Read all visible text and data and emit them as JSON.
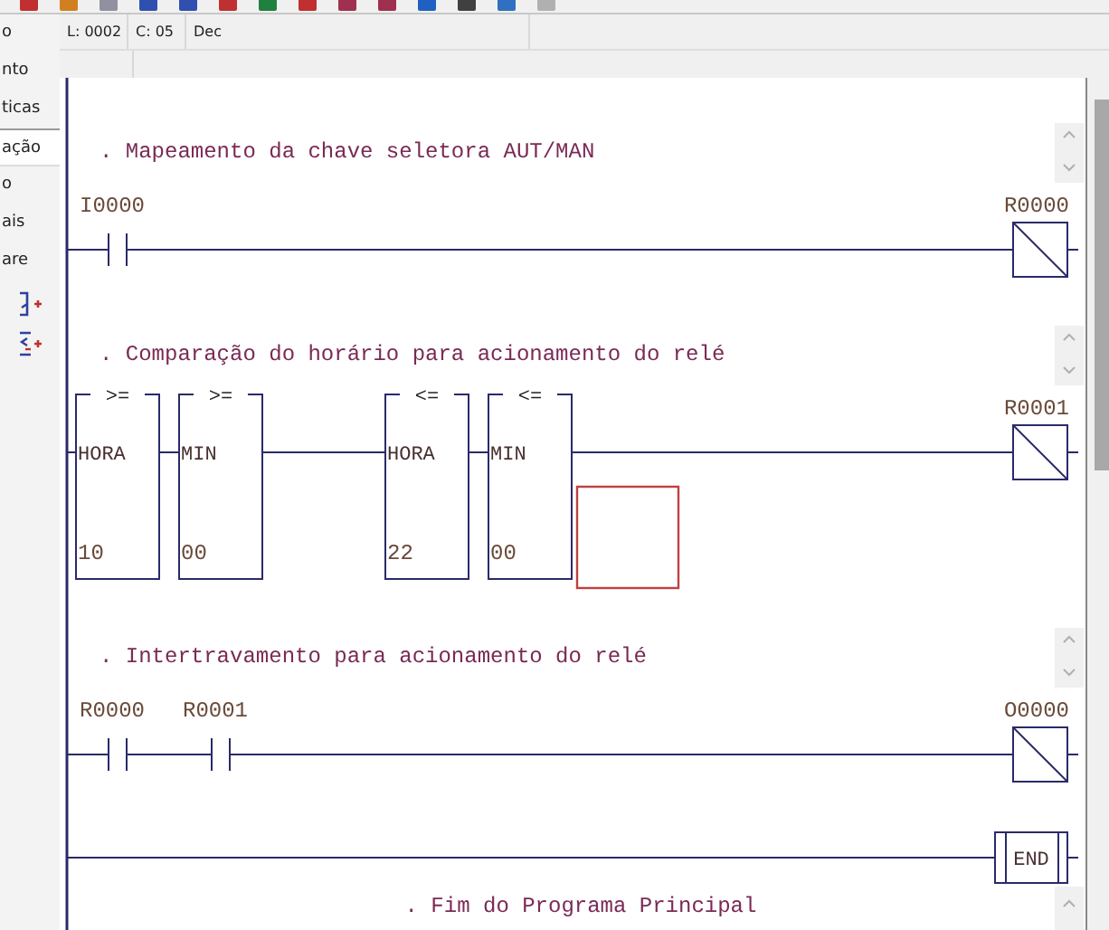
{
  "status_bar": {
    "line": "L: 0002",
    "column": "C: 05",
    "base": "Dec"
  },
  "sidebar": {
    "items": [
      {
        "label": "o",
        "selected": false
      },
      {
        "label": "nto",
        "selected": false
      },
      {
        "label": "ticas",
        "selected": false
      },
      {
        "label": "ação",
        "selected": true
      },
      {
        "label": "o",
        "selected": false
      },
      {
        "label": "ais",
        "selected": false
      },
      {
        "label": "are",
        "selected": false
      }
    ]
  },
  "ladder": {
    "rungs": [
      {
        "comment": ". Mapeamento da chave seletora AUT/MAN",
        "elements": [
          {
            "kind": "contact",
            "label": "I0000"
          }
        ],
        "coil": {
          "kind": "coil",
          "label": "R0000"
        }
      },
      {
        "comment": ". Comparação do horário para acionamento do relé",
        "elements": [
          {
            "kind": "compare",
            "op": ">=",
            "operand": "HORA",
            "value": "10"
          },
          {
            "kind": "compare",
            "op": ">=",
            "operand": "MIN",
            "value": "00"
          },
          {
            "kind": "wire"
          },
          {
            "kind": "compare",
            "op": "<=",
            "operand": "HORA",
            "value": "22"
          },
          {
            "kind": "compare",
            "op": "<=",
            "operand": "MIN",
            "value": "00"
          },
          {
            "kind": "cursor"
          }
        ],
        "coil": {
          "kind": "coil",
          "label": "R0001"
        }
      },
      {
        "comment": ". Intertravamento para acionamento do relé",
        "elements": [
          {
            "kind": "contact",
            "label": "R0000"
          },
          {
            "kind": "contact",
            "label": "R0001"
          }
        ],
        "coil": {
          "kind": "coil",
          "label": "O0000"
        }
      },
      {
        "coil": {
          "kind": "end",
          "label": "END"
        }
      }
    ],
    "end_comment": ". Fim do Programa Principal"
  }
}
